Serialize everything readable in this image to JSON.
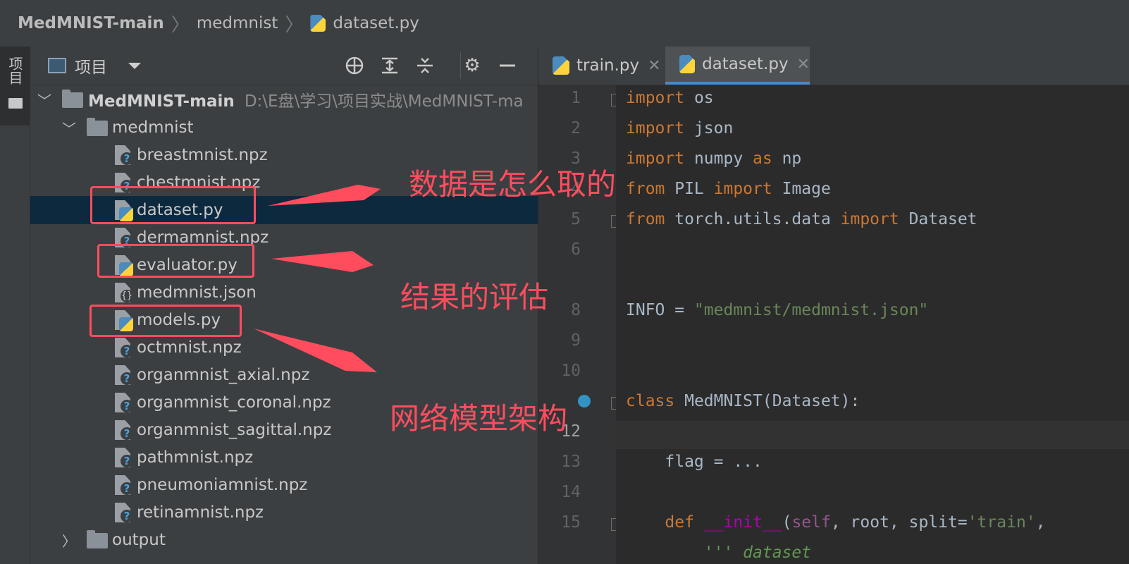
{
  "breadcrumb": {
    "items": [
      "MedMNIST-main",
      "medmnist",
      "dataset.py"
    ]
  },
  "side_strip": {
    "label": "项目"
  },
  "project_toolbar": {
    "title": "项目",
    "icons": [
      "crosshair-icon",
      "expand-all-icon",
      "collapse-all-icon",
      "gear-icon",
      "minimize-icon"
    ]
  },
  "tree": {
    "root": {
      "name": "MedMNIST-main",
      "path": "D:\\E盘\\学习\\项目实战\\MedMNIST-ma"
    },
    "folder": "medmnist",
    "files": [
      "breastmnist.npz",
      "chestmnist.npz",
      "dataset.py",
      "dermamnist.npz",
      "evaluator.py",
      "medmnist.json",
      "models.py",
      "octmnist.npz",
      "organmnist_axial.npz",
      "organmnist_coronal.npz",
      "organmnist_sagittal.npz",
      "pathmnist.npz",
      "pneumoniamnist.npz",
      "retinamnist.npz"
    ],
    "output_folder": "output"
  },
  "tabs": [
    {
      "label": "train.py"
    },
    {
      "label": "dataset.py"
    }
  ],
  "editor": {
    "line_numbers": [
      "1",
      "2",
      "3",
      "4",
      "5",
      "6",
      "",
      "8",
      "9",
      "10",
      "",
      "12",
      "13",
      "14",
      "15",
      ""
    ],
    "code": {
      "l1_kw": "import",
      "l1_rest": " os",
      "l2_kw": "import",
      "l2_rest": " json",
      "l3_kw": "import",
      "l3_mid": " numpy ",
      "l3_kw2": "as",
      "l3_rest": " np",
      "l4_kw": "from",
      "l4_mid": " PIL ",
      "l4_kw2": "import",
      "l4_rest": " Image",
      "l5_kw": "from",
      "l5_mid": " torch.utils.data ",
      "l5_kw2": "import",
      "l5_rest": " Dataset",
      "l8_left": "INFO = ",
      "l8_str": "\"medmnist/medmnist.json\"",
      "l11_kw": "class",
      "l11_rest": " MedMNIST(Dataset):",
      "l13": "    flag = ...",
      "l15_indent": "    ",
      "l15_kw": "def",
      "l15_sp": " ",
      "l15_dunder": "__init__",
      "l15_p1": "(",
      "l15_self": "self",
      "l15_p2": ", root, split=",
      "l15_str": "'train'",
      "l15_p3": ",",
      "l16_indent": "        ",
      "l16_doc": "''' dataset"
    }
  },
  "annotations": {
    "dataset": "数据是怎么取的",
    "evaluator": "结果的评估",
    "models": "网络模型架构",
    "color": "#ff4d5e"
  },
  "colors": {
    "keyword": "#cc7832",
    "string": "#6a8759",
    "selection": "#0d293e",
    "tab_underline": "#4a88c7"
  }
}
